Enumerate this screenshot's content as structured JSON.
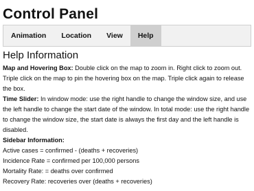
{
  "page": {
    "title": "Control Panel"
  },
  "tabs": [
    {
      "label": "Animation",
      "active": false
    },
    {
      "label": "Location",
      "active": false
    },
    {
      "label": "View",
      "active": false
    },
    {
      "label": "Help",
      "active": true
    }
  ],
  "help": {
    "heading": "Help Information",
    "map_box": {
      "label": "Map and Hovering Box:",
      "text": " Double click on the map to zoom in. Right click to zoom out. Triple click on the map to pin the hovering box on the map. Triple click again to release the box."
    },
    "time_slider": {
      "label": "Time Slider:",
      "text": " In window mode: use the right handle to change the window size, and use the left handle to change the start date of the window. In total mode: use the right handle to change the window size, the start date is always the first day and the left handle is disabled."
    },
    "sidebar": {
      "label": "Sidebar Information:",
      "lines": [
        "Active cases = confirmed - (deaths + recoveries)",
        "Incidence Rate = confirmed per 100,000 persons",
        "Mortality Rate: = deaths over confirmed",
        "Recovery Rate: recoveries over (deaths + recoveries)"
      ]
    }
  },
  "colors": {
    "tabbar_bg": "#f1f1f1",
    "active_tab_bg": "#cfcfcf",
    "text": "#111111"
  }
}
